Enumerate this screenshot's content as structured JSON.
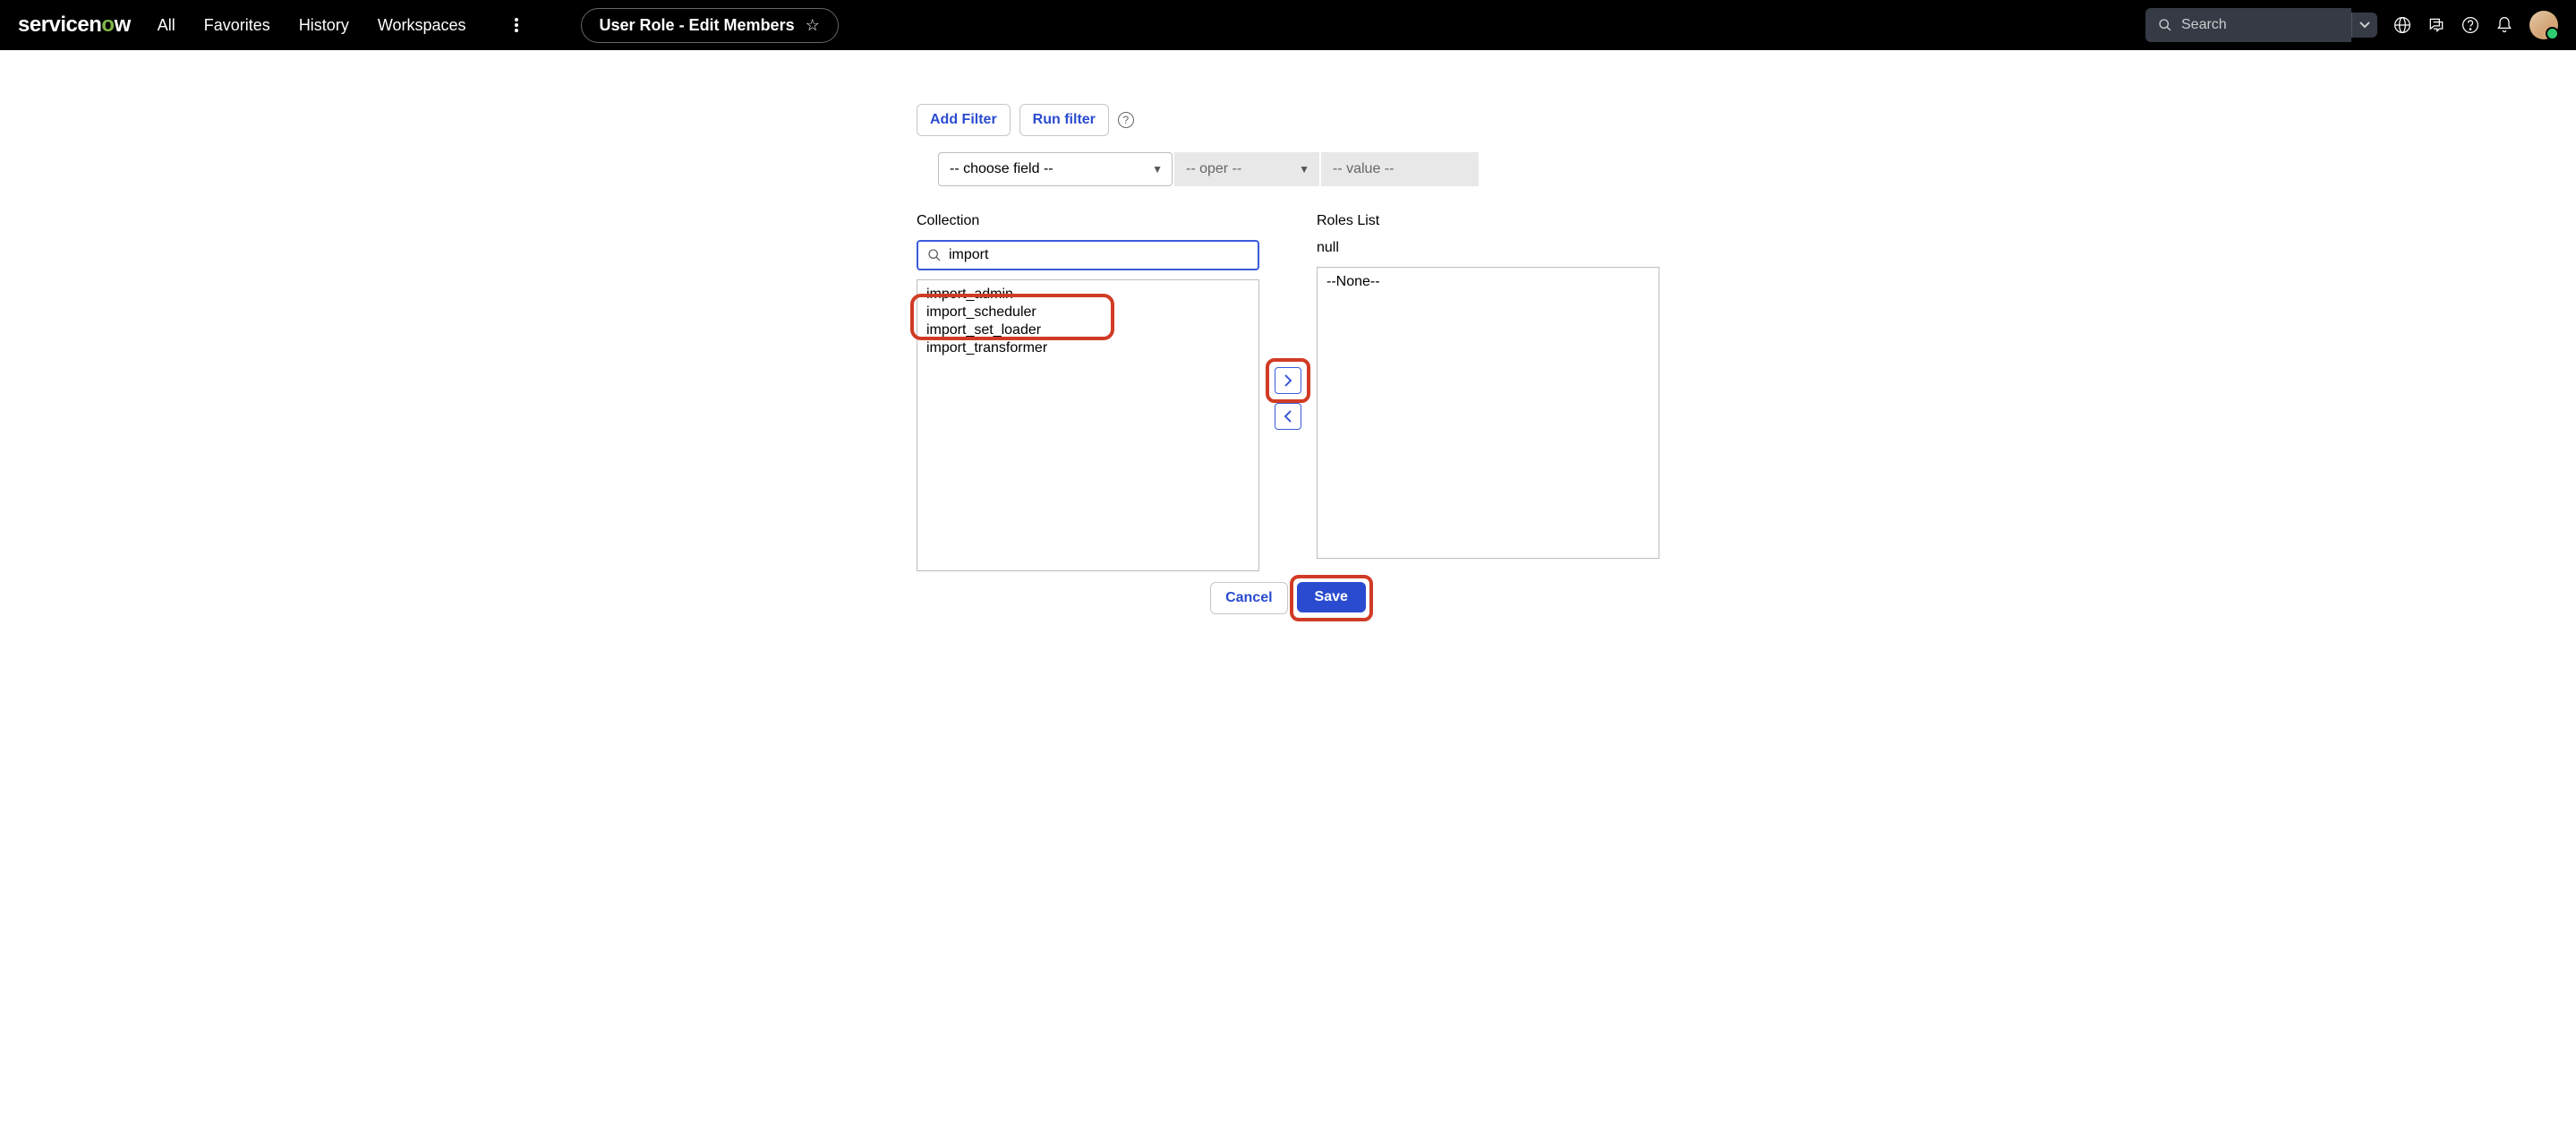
{
  "header": {
    "logo_prefix": "service",
    "logo_mid": "n",
    "logo_o": "o",
    "logo_suffix": "w",
    "nav": [
      "All",
      "Favorites",
      "History",
      "Workspaces"
    ],
    "title": "User Role - Edit Members",
    "search_placeholder": "Search"
  },
  "filter": {
    "add_filter": "Add Filter",
    "run_filter": "Run filter",
    "field_placeholder": "-- choose field --",
    "oper_placeholder": "-- oper --",
    "value_placeholder": "-- value --"
  },
  "labels": {
    "collection": "Collection",
    "roles": "Roles List",
    "roles_null": "null"
  },
  "search_value": "import",
  "collection_items": [
    "import_admin",
    "import_scheduler",
    "import_set_loader",
    "import_transformer"
  ],
  "roles_items": [
    "--None--"
  ],
  "buttons": {
    "cancel": "Cancel",
    "save": "Save"
  }
}
